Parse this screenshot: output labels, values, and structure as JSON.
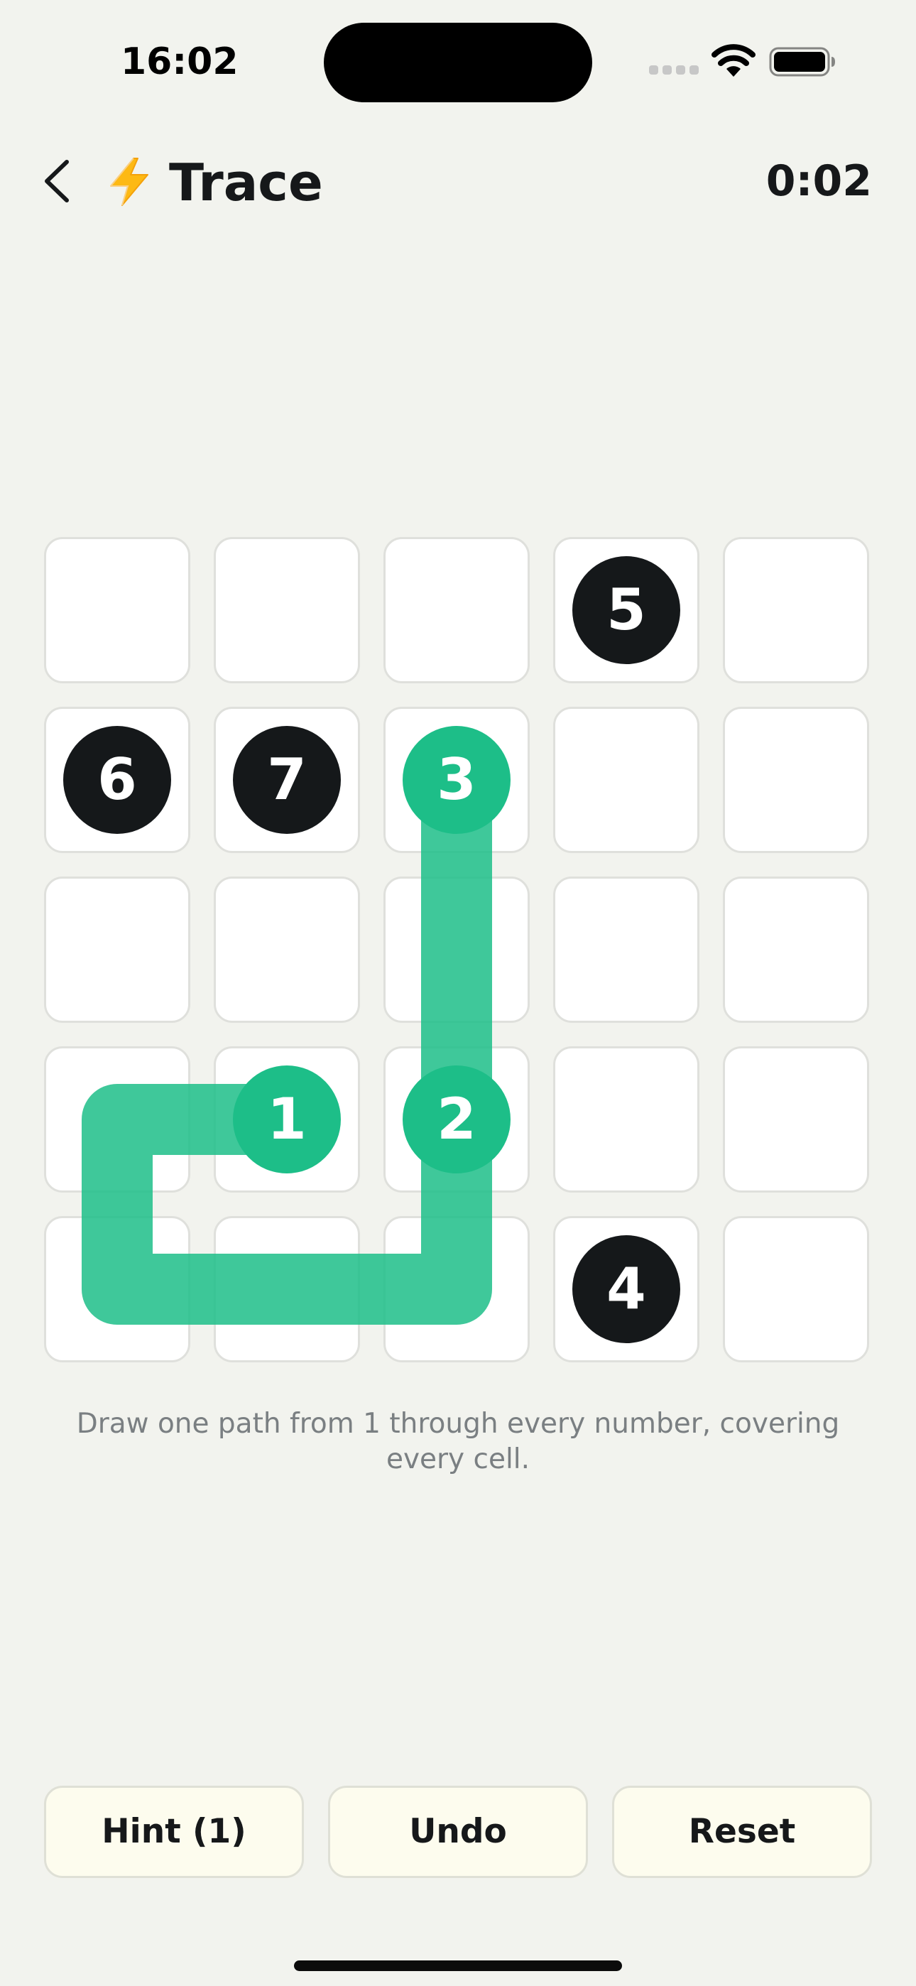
{
  "status_bar": {
    "time": "16:02"
  },
  "header": {
    "back_icon": "chevron-left-icon",
    "app_icon": "lightning-bolt-icon",
    "title": "Trace",
    "timer": "0:02"
  },
  "colors": {
    "background": "#f2f3ee",
    "path": "#1dbe88",
    "numbered_node": "#15181a",
    "button_fill": "#fdfcee"
  },
  "board": {
    "rows": 5,
    "cols": 5,
    "numbers": [
      {
        "label": "5",
        "row": 0,
        "col": 3,
        "visited": false
      },
      {
        "label": "6",
        "row": 1,
        "col": 0,
        "visited": false
      },
      {
        "label": "7",
        "row": 1,
        "col": 1,
        "visited": false
      },
      {
        "label": "3",
        "row": 1,
        "col": 2,
        "visited": true
      },
      {
        "label": "1",
        "row": 3,
        "col": 1,
        "visited": true
      },
      {
        "label": "2",
        "row": 3,
        "col": 2,
        "visited": true
      },
      {
        "label": "4",
        "row": 4,
        "col": 3,
        "visited": false
      }
    ],
    "path": [
      [
        3,
        1
      ],
      [
        3,
        0
      ],
      [
        4,
        0
      ],
      [
        4,
        1
      ],
      [
        4,
        2
      ],
      [
        3,
        2
      ],
      [
        2,
        2
      ],
      [
        1,
        2
      ]
    ]
  },
  "instruction": "Draw one path from 1 through every number, covering every cell.",
  "buttons": {
    "hint": "Hint (1)",
    "undo": "Undo",
    "reset": "Reset"
  }
}
